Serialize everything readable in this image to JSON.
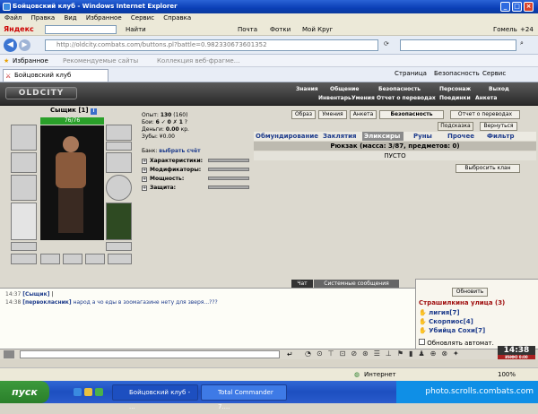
{
  "window": {
    "title": "Бойцовский клуб - Windows Internet Explorer"
  },
  "menu": [
    "Файл",
    "Правка",
    "Вид",
    "Избранное",
    "Сервис",
    "Справка"
  ],
  "yandex": {
    "brand": "Яндекс",
    "find": "Найти",
    "mail": "Почта",
    "photos": "Фотки",
    "mycomputer": "Мой Круг",
    "city": "Гомель",
    "temp": "+24"
  },
  "address": {
    "url": "http://oldcity.combats.com/buttons.pl?battle=0.982330673601352"
  },
  "favorites": {
    "label": "Избранное",
    "recommended": "Рекомендуемые сайты",
    "gallery": "Коллекция веб-фрагме..."
  },
  "tab": {
    "label": "Бойцовский клуб"
  },
  "cmdbar": {
    "page": "Страница",
    "safety": "Безопасность",
    "tools": "Сервис"
  },
  "game": {
    "logo": "OLDCITY",
    "nav": [
      "Знания",
      "Общение",
      "Безопасность",
      "Персонаж",
      "Выход"
    ],
    "subnav": [
      "Инвентарь",
      "Умения",
      "Отчет о переводах",
      "Поединки",
      "Анкета"
    ],
    "player": {
      "name": "Сыщик",
      "level": "[1]",
      "hp": "76/76"
    },
    "stats": {
      "exp_label": "Опыт:",
      "exp": "130",
      "exp_next": "(160)",
      "wins_label": "Бои:",
      "wins": "6",
      "losses": "0",
      "draws": "1",
      "money_label": "Деньги:",
      "money": "0.00",
      "money_unit": "кр.",
      "teeth_label": "Зубы:",
      "teeth": "0.00"
    },
    "bank": {
      "label": "Банк:",
      "link": "выбрать счёт"
    },
    "sections": [
      "Характеристики:",
      "Модификаторы:",
      "Мощность:",
      "Защита:"
    ],
    "top_buttons": [
      "Образ",
      "Умения",
      "Анкета",
      "Безопасность",
      "Отчет о переводах"
    ],
    "help_button": "Подсказка",
    "return_button": "Вернуться",
    "inv_tabs": [
      "Обмундирование",
      "Заклятия",
      "Эликсиры",
      "Руны",
      "Прочее",
      "Фильтр"
    ],
    "backpack": "Рюкзак (масса: 3/87, предметов: 0)",
    "empty": "ПУСТО",
    "clan_button": "Выбросить клан"
  },
  "chat": {
    "tabs": [
      "Чат",
      "Системные сообщения"
    ],
    "lines": [
      {
        "time": "14:37",
        "user": "[Сыщик]",
        "msg": "|"
      },
      {
        "time": "14:38",
        "user": "[первокласник]",
        "msg": "народ а чо еды в зоомагазине нету для зверя...???"
      }
    ]
  },
  "users": {
    "refresh": "Обновить",
    "location": "Страшилкина улица (3)",
    "list": [
      {
        "name": "лигия",
        "lvl": "[7]"
      },
      {
        "name": "Скорпиос",
        "lvl": "[4]"
      },
      {
        "name": "Убийца Сохи",
        "lvl": "[7]"
      }
    ],
    "auto": "Обновлять автомат."
  },
  "clock": {
    "time": "14:38",
    "sub": "ИНФО 0:00"
  },
  "status": {
    "zone": "Интернет",
    "zoom": "100%"
  },
  "taskbar": {
    "start": "пуск",
    "win1": "Бойцовский клуб - ...",
    "win2": "Total Commander 7....",
    "watermark": "photo.scrolls.combats.com"
  },
  "colors": {
    "accent": "#2f5fae",
    "hp": "#2aa02a",
    "user_name": "#1e3c8c",
    "location": "#a01010",
    "chat_user": "#1e3c8c"
  }
}
